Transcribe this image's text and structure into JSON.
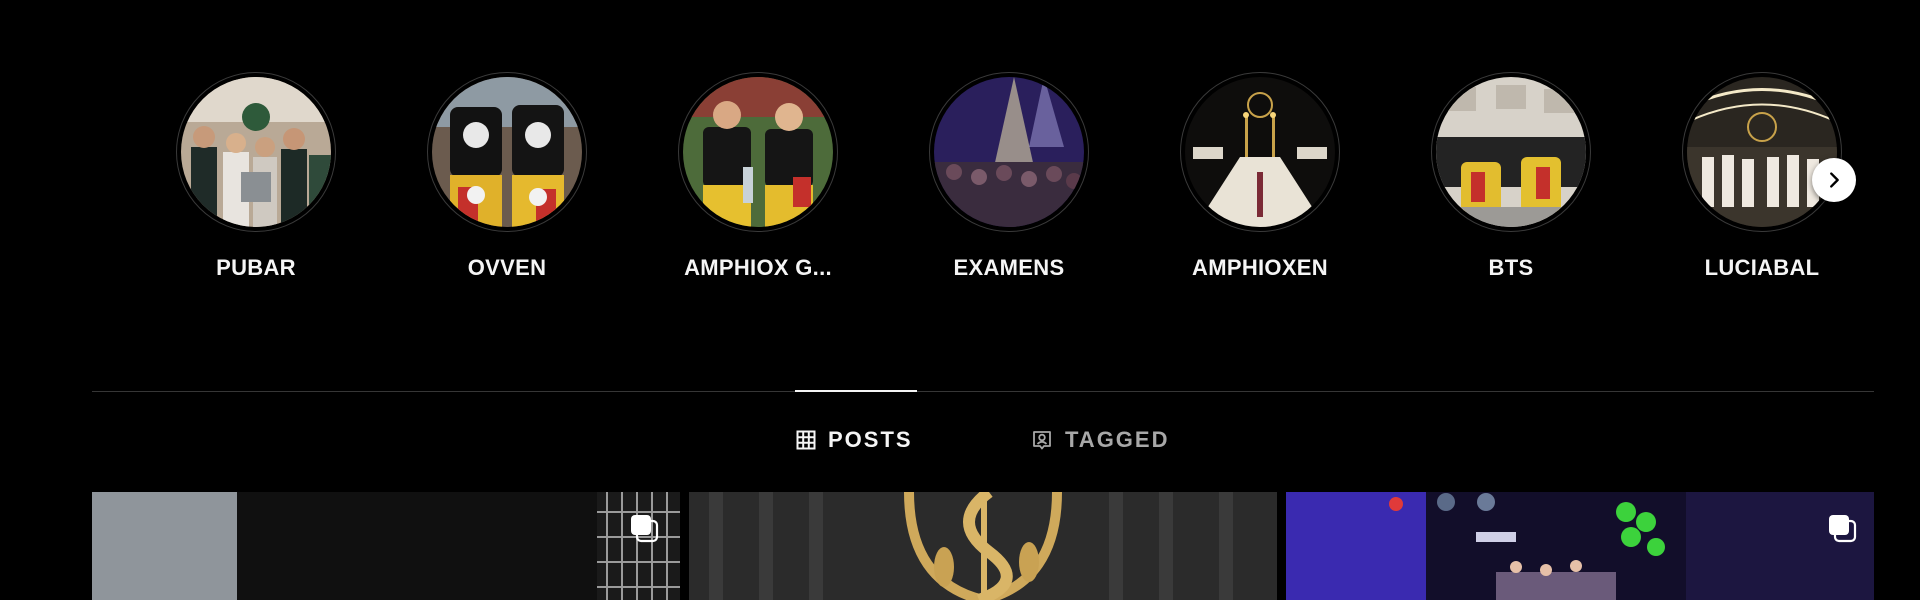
{
  "highlights": [
    {
      "label": "PUBAR",
      "thumb": "group-bar-photo"
    },
    {
      "label": "OVVEN",
      "thumb": "overalls-photo"
    },
    {
      "label": "AMPHIOX G...",
      "thumb": "two-people-photo"
    },
    {
      "label": "EXAMENS",
      "thumb": "party-lights-photo"
    },
    {
      "label": "AMPHIOXEN",
      "thumb": "banquet-table-photo"
    },
    {
      "label": "BTS",
      "thumb": "sofa-legs-photo"
    },
    {
      "label": "LUCIABAL",
      "thumb": "lucia-hall-photo"
    }
  ],
  "next_icon": "chevron-right-icon",
  "tabs": [
    {
      "label": "POSTS",
      "icon": "grid-icon",
      "active": true
    },
    {
      "label": "TAGGED",
      "icon": "tagged-icon",
      "active": false
    }
  ],
  "posts": [
    {
      "thumb": "dark-room-photo",
      "multi": true
    },
    {
      "thumb": "gold-emblem-curtain-photo",
      "multi": false
    },
    {
      "thumb": "purple-club-photo",
      "multi": true
    }
  ],
  "colors": {
    "background": "#000000",
    "text": "#f5f5f5",
    "muted_text": "#a8a8a8",
    "divider": "#363636"
  }
}
